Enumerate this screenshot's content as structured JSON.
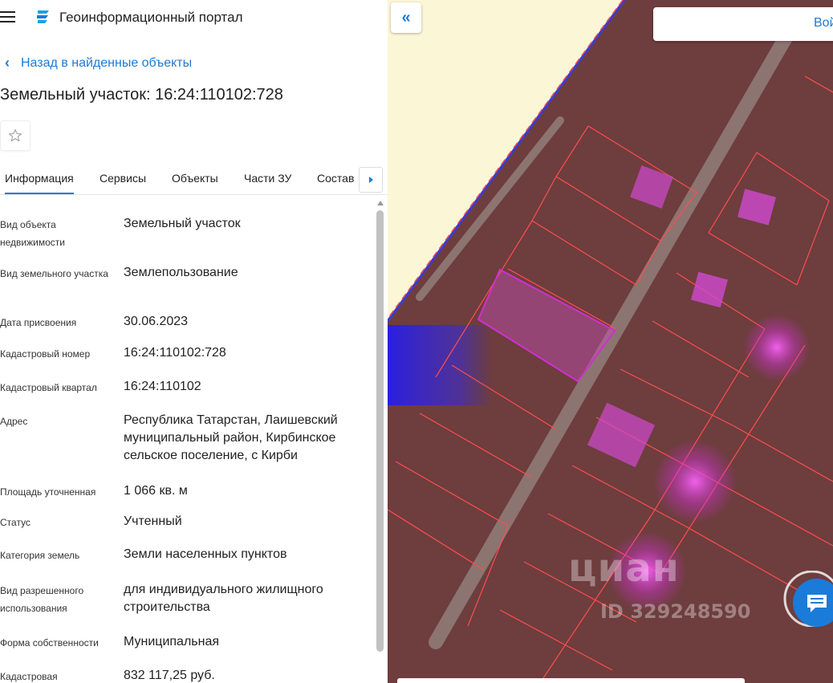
{
  "header": {
    "app_title": "Геоинформационный портал",
    "menu_icon": "hamburger-icon",
    "logo_icon": "portal-logo-icon"
  },
  "navigation": {
    "back_label": "Назад в найденные объекты"
  },
  "object": {
    "title": "Земельный участок: 16:24:110102:728"
  },
  "tabs": [
    {
      "label": "Информация",
      "active": true
    },
    {
      "label": "Сервисы"
    },
    {
      "label": "Объекты"
    },
    {
      "label": "Части ЗУ"
    },
    {
      "label": "Состав"
    }
  ],
  "properties": [
    {
      "label": "Вид объекта недвижимости",
      "value": "Земельный участок"
    },
    {
      "label": "Вид земельного участка",
      "value": "Землепользование"
    },
    {
      "label": "Дата присвоения",
      "value": "30.06.2023"
    },
    {
      "label": "Кадастровый номер",
      "value": "16:24:110102:728"
    },
    {
      "label": "Кадастровый квартал",
      "value": "16:24:110102"
    },
    {
      "label": "Адрес",
      "value": "Республика Татарстан, Лаишевский муниципальный район, Кирбинское сельское поселение, с Кирби"
    },
    {
      "label": "Площадь уточненная",
      "value": "1 066 кв. м"
    },
    {
      "label": "Статус",
      "value": "Учтенный"
    },
    {
      "label": "Категория земель",
      "value": "Земли населенных пунктов"
    },
    {
      "label": "Вид разрешенного использования",
      "value": "для индивидуального жилищного строительства"
    },
    {
      "label": "Форма собственности",
      "value": "Муниципальная"
    },
    {
      "label": "Кадастровая",
      "value": "832 117,25 руб."
    }
  ],
  "map": {
    "collapse_label": "«",
    "login_label": "Вой",
    "watermark_logo": "циан",
    "watermark_id": "ID 329248590",
    "chat_icon": "chat-icon"
  },
  "colors": {
    "accent": "#1a7bd8",
    "parcel_border": "#ff4d4d",
    "selected_parcel": "#d02fd0"
  }
}
